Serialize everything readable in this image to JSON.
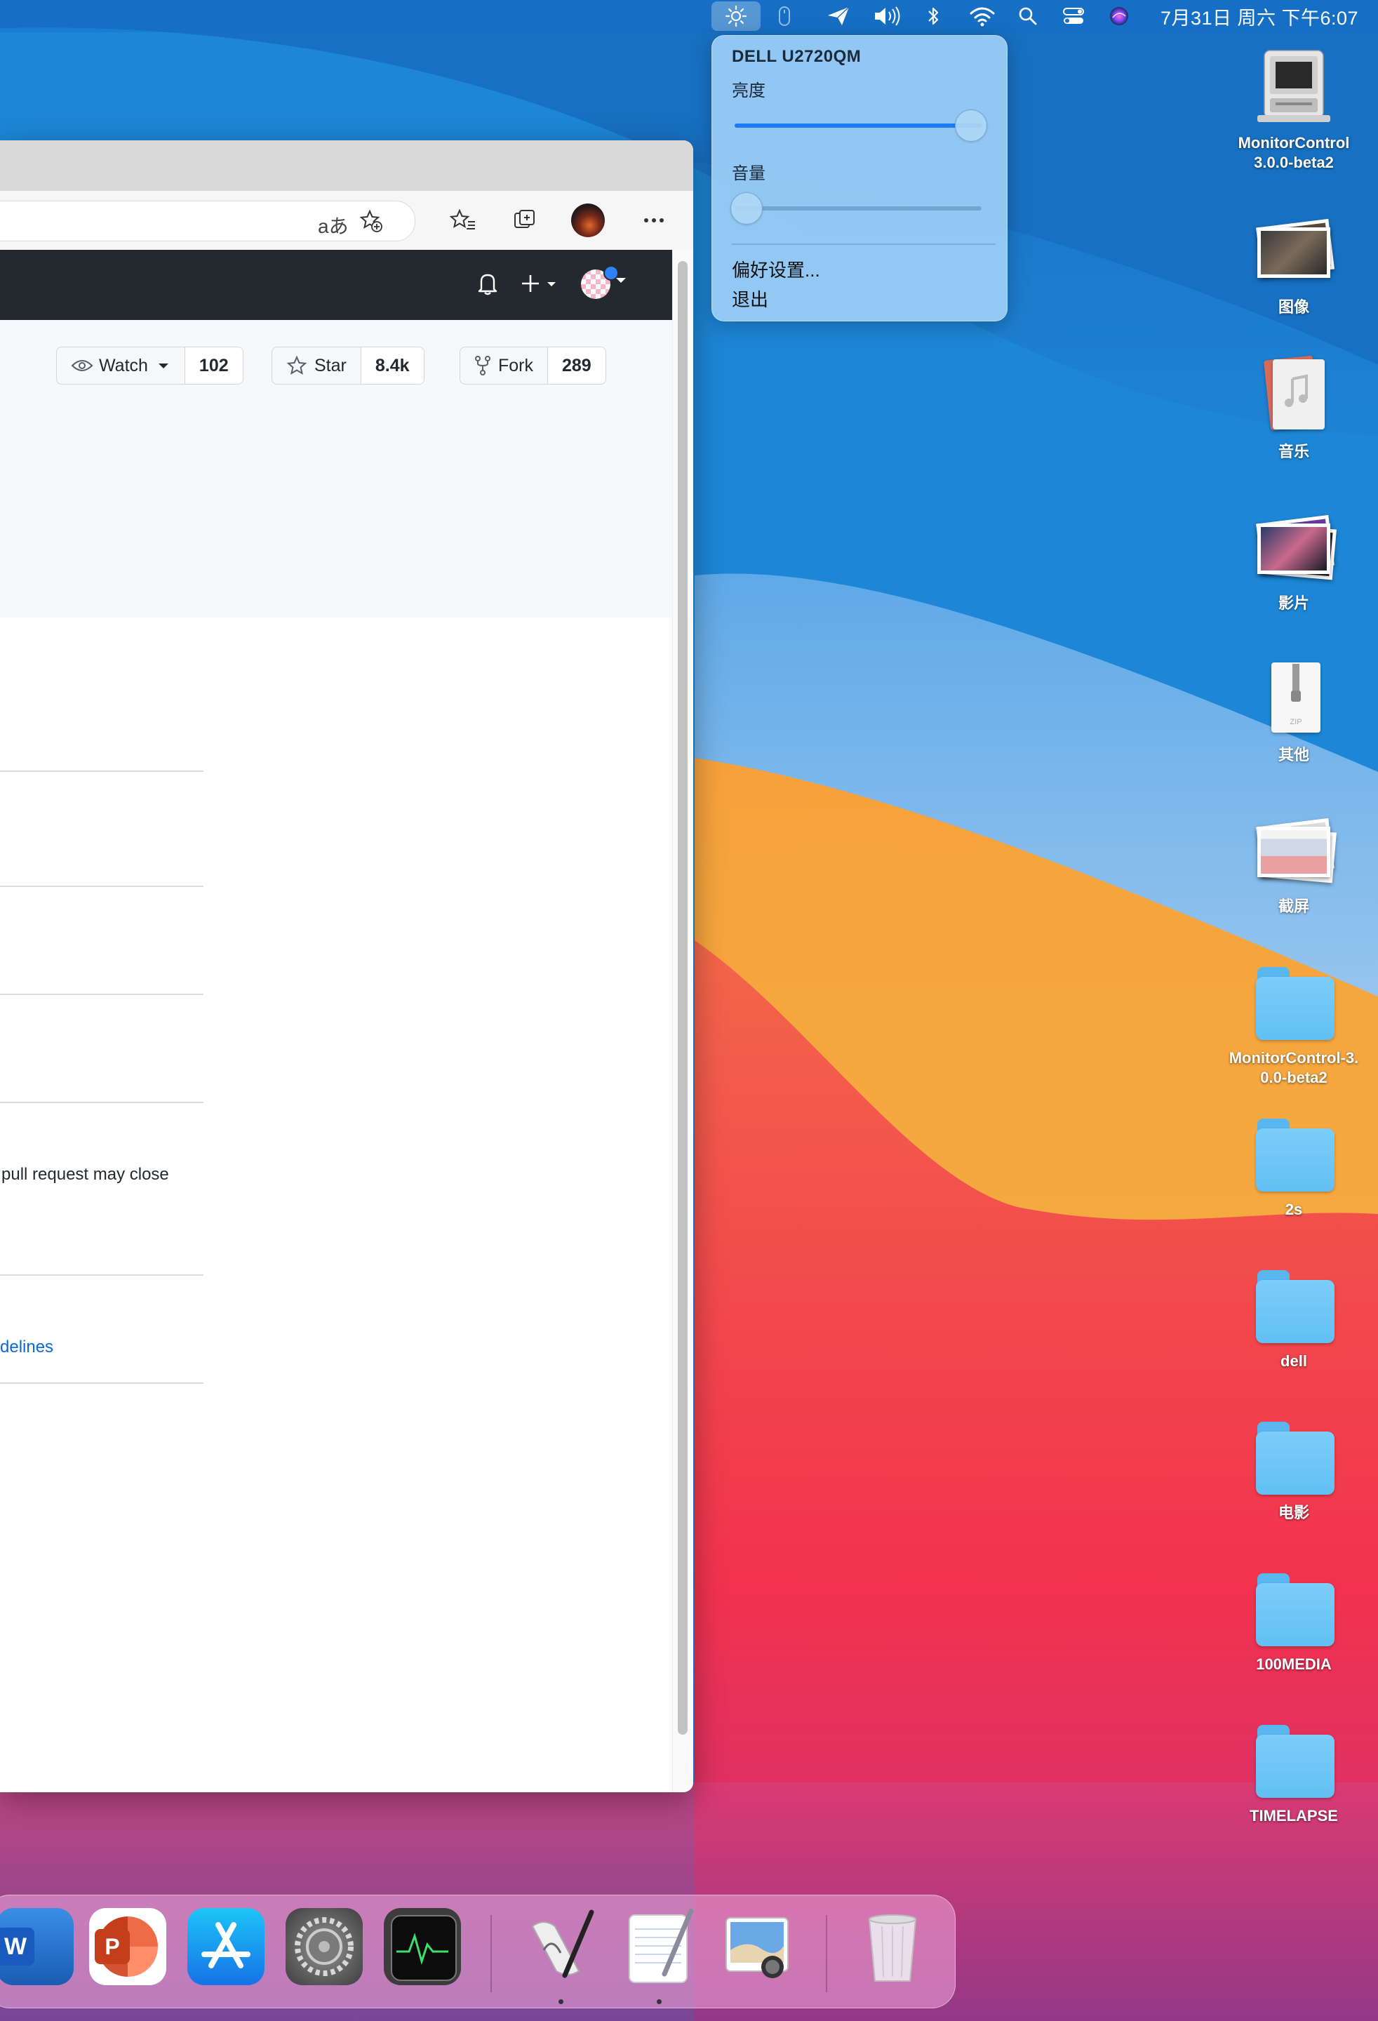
{
  "menubar": {
    "clock": "7月31日 周六 下午6:07",
    "icons": [
      "brightness-icon",
      "mouse-icon",
      "send-icon",
      "volume-icon",
      "bluetooth-icon",
      "wifi-icon",
      "search-icon",
      "control-center-icon",
      "siri-icon"
    ]
  },
  "monitor_popup": {
    "title": "DELL U2720QM",
    "brightness_label": "亮度",
    "brightness_value": 1.0,
    "volume_label": "音量",
    "volume_value": 0.0,
    "preferences": "偏好设置...",
    "quit": "退出"
  },
  "browser": {
    "toolbar": {
      "translate_label": "aあ"
    },
    "repo_actions": {
      "watch_label": "Watch",
      "watch_count": "102",
      "star_label": "Star",
      "star_count": "8.4k",
      "fork_label": "Fork",
      "fork_count": "289"
    },
    "content": {
      "pull_request_text": "pull request may close",
      "guidelines_link": "delines"
    }
  },
  "desktop_icons": [
    {
      "label_line1": "MonitorControl",
      "label_line2": "3.0.0-beta2",
      "type": "dmg"
    },
    {
      "label_line1": "图像",
      "type": "photos"
    },
    {
      "label_line1": "音乐",
      "type": "music"
    },
    {
      "label_line1": "影片",
      "type": "movies"
    },
    {
      "label_line1": "其他",
      "type": "zip"
    },
    {
      "label_line1": "截屏",
      "type": "screenshots"
    },
    {
      "label_line1": "MonitorControl-3.",
      "label_line2": "0.0-beta2",
      "type": "folder"
    },
    {
      "label_line1": "2s",
      "type": "folder"
    },
    {
      "label_line1": "dell",
      "type": "folder"
    },
    {
      "label_line1": "电影",
      "type": "folder"
    },
    {
      "label_line1": "100MEDIA",
      "type": "folder"
    },
    {
      "label_line1": "TIMELAPSE",
      "type": "folder"
    }
  ],
  "dock": {
    "apps": [
      "word",
      "powerpoint",
      "app-store",
      "system-preferences",
      "activity-monitor",
      "script-editor",
      "textedit",
      "preview",
      "trash"
    ],
    "word_letter": "W",
    "powerpoint_letter": "P"
  },
  "colors": {
    "accent": "#1e7cf2",
    "github_header": "#24292f",
    "link": "#0969da"
  }
}
